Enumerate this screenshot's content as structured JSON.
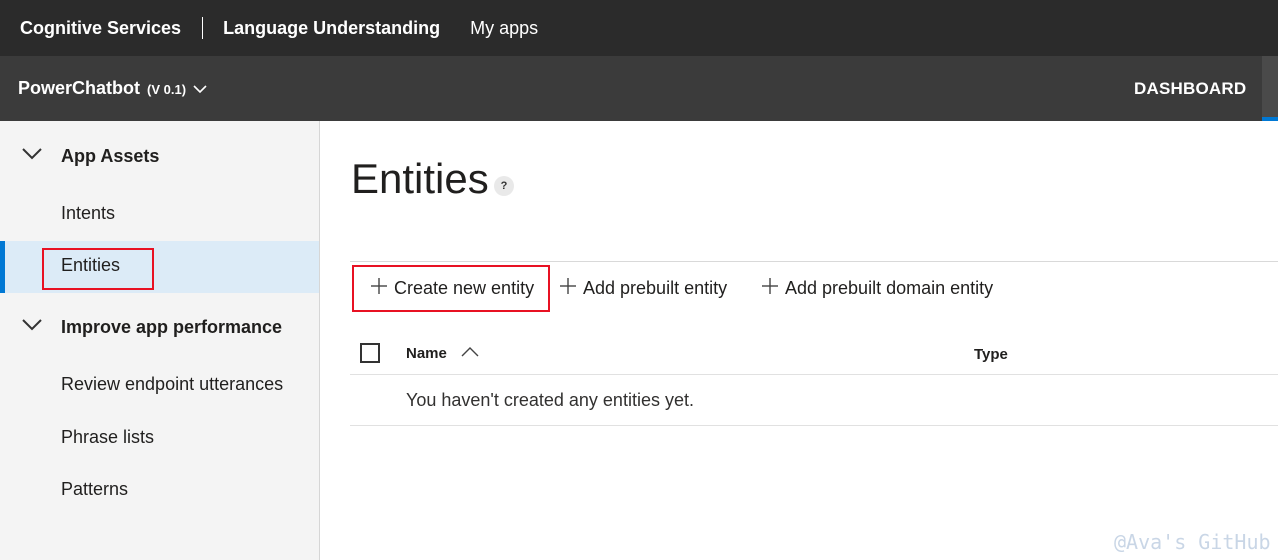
{
  "topbar": {
    "brand": "Cognitive Services",
    "product": "Language Understanding",
    "my_apps": "My apps"
  },
  "appbar": {
    "app_name": "PowerChatbot",
    "version": "(V 0.1)",
    "dashboard": "DASHBOARD",
    "accent_color": "#0078d4"
  },
  "sidebar": {
    "group_assets": "App Assets",
    "intents": "Intents",
    "entities": "Entities",
    "group_performance": "Improve app performance",
    "review_endpoint": "Review endpoint utterances",
    "phrase_lists": "Phrase lists",
    "patterns": "Patterns"
  },
  "main": {
    "title": "Entities",
    "help": "?",
    "commands": {
      "create": "Create new entity",
      "add_prebuilt": "Add prebuilt entity",
      "add_domain": "Add prebuilt domain entity"
    },
    "table": {
      "col_name": "Name",
      "col_type": "Type",
      "empty_message": "You haven't created any entities yet."
    }
  },
  "watermark": "@Ava's GitHub"
}
